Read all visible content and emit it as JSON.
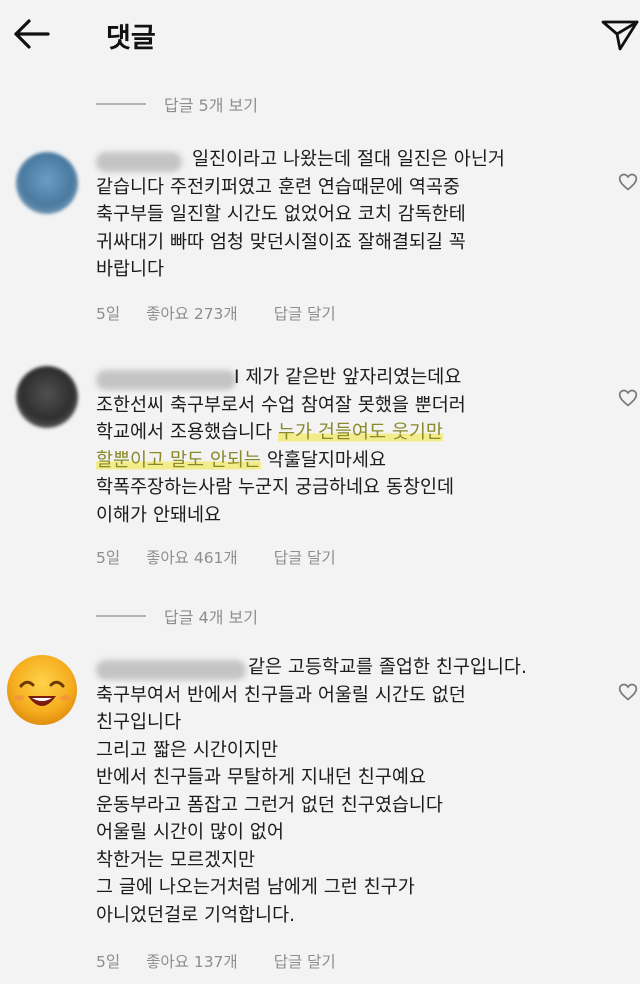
{
  "header": {
    "title": "댓글",
    "back_icon": "arrow-left-icon",
    "send_icon": "paper-plane-icon"
  },
  "toggle1": {
    "label": "답글 5개 보기"
  },
  "toggle2": {
    "label": "답글 4개 보기"
  },
  "comments": [
    {
      "lines": [
        "일진이라고 나왔는데 절대 일진은 아닌거",
        "같습니다 주전키퍼였고 훈련 연습때문에 역곡중",
        "축구부들 일진할 시간도 없었어요 코치 감독한테",
        "귀싸대기 빠따 엄청 맞던시절이죠 잘해결되길 꼭",
        "바랍니다"
      ],
      "time": "5일",
      "likes": "좋아요 273개",
      "reply": "답글 달기"
    },
    {
      "lines": [
        "I 제가 같은반 앞자리였는데요",
        "조한선씨 축구부로서 수업 참여잘 못했을 뿐더러"
      ],
      "line3_plain": "학교에서 조용했습니다 ",
      "line3_hl": "누가 건들여도 웃기만",
      "line4_hl": "할뿐이고 말도 안되는",
      "line4_plain": " 악훌달지마세요",
      "lines_after": [
        "학폭주장하는사람 누군지 궁금하네요 동창인데",
        "이해가 안돼네요"
      ],
      "time": "5일",
      "likes": "좋아요 461개",
      "reply": "답글 달기"
    },
    {
      "lines": [
        "같은 고등학교를 졸업한 친구입니다.",
        "축구부여서 반에서 친구들과 어울릴 시간도 없던",
        "친구입니다",
        "그리고 짧은 시간이지만",
        "반에서 친구들과 무탈하게 지내던 친구예요",
        "운동부라고 폼잡고 그런거 없던 친구였습니다",
        "어울릴 시간이 많이 없어",
        "착한거는 모르겠지만",
        "그 글에 나오는거처럼 남에게 그런 친구가",
        "아니었던걸로 기억합니다."
      ],
      "time": "5일",
      "likes": "좋아요 137개",
      "reply": "답글 달기"
    }
  ]
}
